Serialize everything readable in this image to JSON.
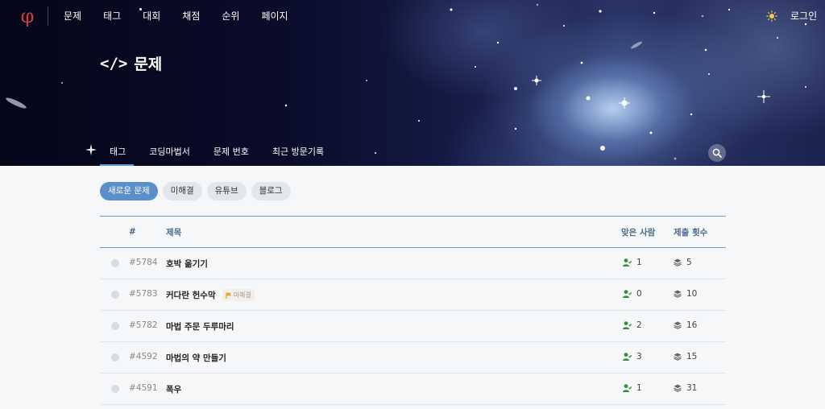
{
  "header": {
    "logo": "φ",
    "menu": [
      {
        "label": "문제"
      },
      {
        "label": "태그"
      },
      {
        "label": "대회"
      },
      {
        "label": "채점"
      },
      {
        "label": "순위"
      },
      {
        "label": "페이지"
      }
    ],
    "login_label": "로그인",
    "theme_icon": "sun-icon"
  },
  "page": {
    "icon_text": "</>",
    "title": "문제"
  },
  "subtabs": [
    {
      "label": "태그",
      "active": true
    },
    {
      "label": "코딩마법서"
    },
    {
      "label": "문제 번호"
    },
    {
      "label": "최근 방문기록"
    }
  ],
  "filters": [
    {
      "label": "새로운 문제",
      "active": true
    },
    {
      "label": "미해결"
    },
    {
      "label": "유튜브"
    },
    {
      "label": "블로그"
    }
  ],
  "table": {
    "headers": {
      "num": "#",
      "title": "제목",
      "solved": "맞은 사람",
      "submissions": "제출 횟수"
    },
    "rows": [
      {
        "num": "#5784",
        "title": "호박 옮기기",
        "badge": "",
        "solved": "1",
        "submissions": "5"
      },
      {
        "num": "#5783",
        "title": "커다란 헌수막",
        "badge": "미해결",
        "solved": "0",
        "submissions": "10"
      },
      {
        "num": "#5782",
        "title": "마법 주문 두루마리",
        "badge": "",
        "solved": "2",
        "submissions": "16"
      },
      {
        "num": "#4592",
        "title": "마법의 약 만들기",
        "badge": "",
        "solved": "3",
        "submissions": "15"
      },
      {
        "num": "#4591",
        "title": "폭우",
        "badge": "",
        "solved": "1",
        "submissions": "31"
      }
    ]
  },
  "colors": {
    "accent": "#5b8fc9",
    "solved_icon": "#2f8f3a",
    "logo": "#d33c3c"
  }
}
